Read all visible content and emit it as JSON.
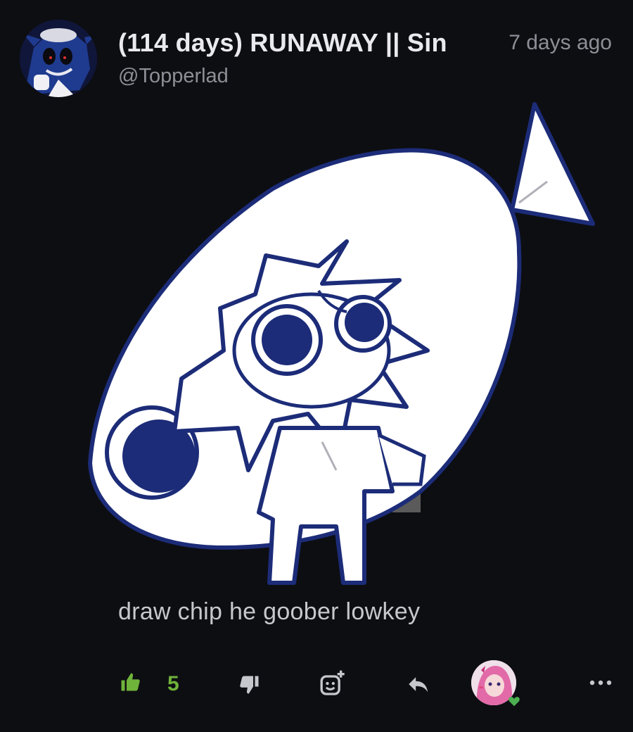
{
  "post": {
    "author_title": "(114 days) RUNAWAY || Sin",
    "handle": "@Topperlad",
    "timestamp": "7 days ago",
    "comment": "draw chip he goober lowkey",
    "image_alt": "chibi character drawing inside a fish shape",
    "likes": "5"
  },
  "icons": {
    "like": "thumbs-up-icon",
    "dislike": "thumbs-down-icon",
    "react": "add-reaction-icon",
    "reply": "reply-icon",
    "more": "more-icon"
  },
  "colors": {
    "background": "#0d0e12",
    "accent_green": "#6fb33a",
    "muted_text": "#8c8f96",
    "title_text": "#e9e9ee",
    "drawing_blue": "#1c2c78"
  }
}
